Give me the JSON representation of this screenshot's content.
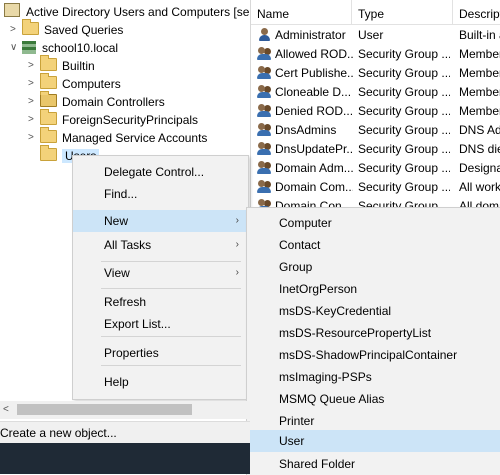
{
  "tree": {
    "root": "Active Directory Users and Computers [serve",
    "saved_queries": "Saved Queries",
    "domain": "school10.local",
    "children": [
      "Builtin",
      "Computers",
      "Domain Controllers",
      "ForeignSecurityPrincipals",
      "Managed Service Accounts",
      "Users"
    ]
  },
  "list": {
    "headers": [
      "Name",
      "Type",
      "Descript"
    ],
    "rows": [
      {
        "name": "Administrator",
        "type": "User",
        "desc": "Built-in a",
        "icon": "user-icon"
      },
      {
        "name": "Allowed ROD...",
        "type": "Security Group ...",
        "desc": "Member",
        "icon": "group-icon"
      },
      {
        "name": "Cert Publishe...",
        "type": "Security Group ...",
        "desc": "Member",
        "icon": "group-icon"
      },
      {
        "name": "Cloneable D...",
        "type": "Security Group ...",
        "desc": "Member",
        "icon": "group-icon"
      },
      {
        "name": "Denied ROD...",
        "type": "Security Group ...",
        "desc": "Member",
        "icon": "group-icon"
      },
      {
        "name": "DnsAdmins",
        "type": "Security Group ...",
        "desc": "DNS Adr",
        "icon": "group-icon"
      },
      {
        "name": "DnsUpdatePr...",
        "type": "Security Group ...",
        "desc": "DNS die",
        "icon": "group-icon"
      },
      {
        "name": "Domain Adm...",
        "type": "Security Group ...",
        "desc": "Designat",
        "icon": "group-icon"
      },
      {
        "name": "Domain Com...",
        "type": "Security Group ...",
        "desc": "All works",
        "icon": "group-icon"
      },
      {
        "name": "Domain Con...",
        "type": "Security Group ...",
        "desc": "All doma",
        "icon": "group-icon"
      }
    ]
  },
  "context_menu": {
    "items": [
      "Delegate Control...",
      "Find...",
      "New",
      "All Tasks",
      "View",
      "Refresh",
      "Export List...",
      "Properties",
      "Help"
    ],
    "highlighted": "New"
  },
  "submenu": {
    "items": [
      "Computer",
      "Contact",
      "Group",
      "InetOrgPerson",
      "msDS-KeyCredential",
      "msDS-ResourcePropertyList",
      "msDS-ShadowPrincipalContainer",
      "msImaging-PSPs",
      "MSMQ Queue Alias",
      "Printer",
      "User",
      "Shared Folder"
    ],
    "highlighted": "User"
  },
  "status": {
    "text": "Create a new object..."
  },
  "colors": {
    "highlight": "#cce4f7",
    "menu_bg": "#f2f2f2",
    "taskbar": "#1f2a36"
  }
}
